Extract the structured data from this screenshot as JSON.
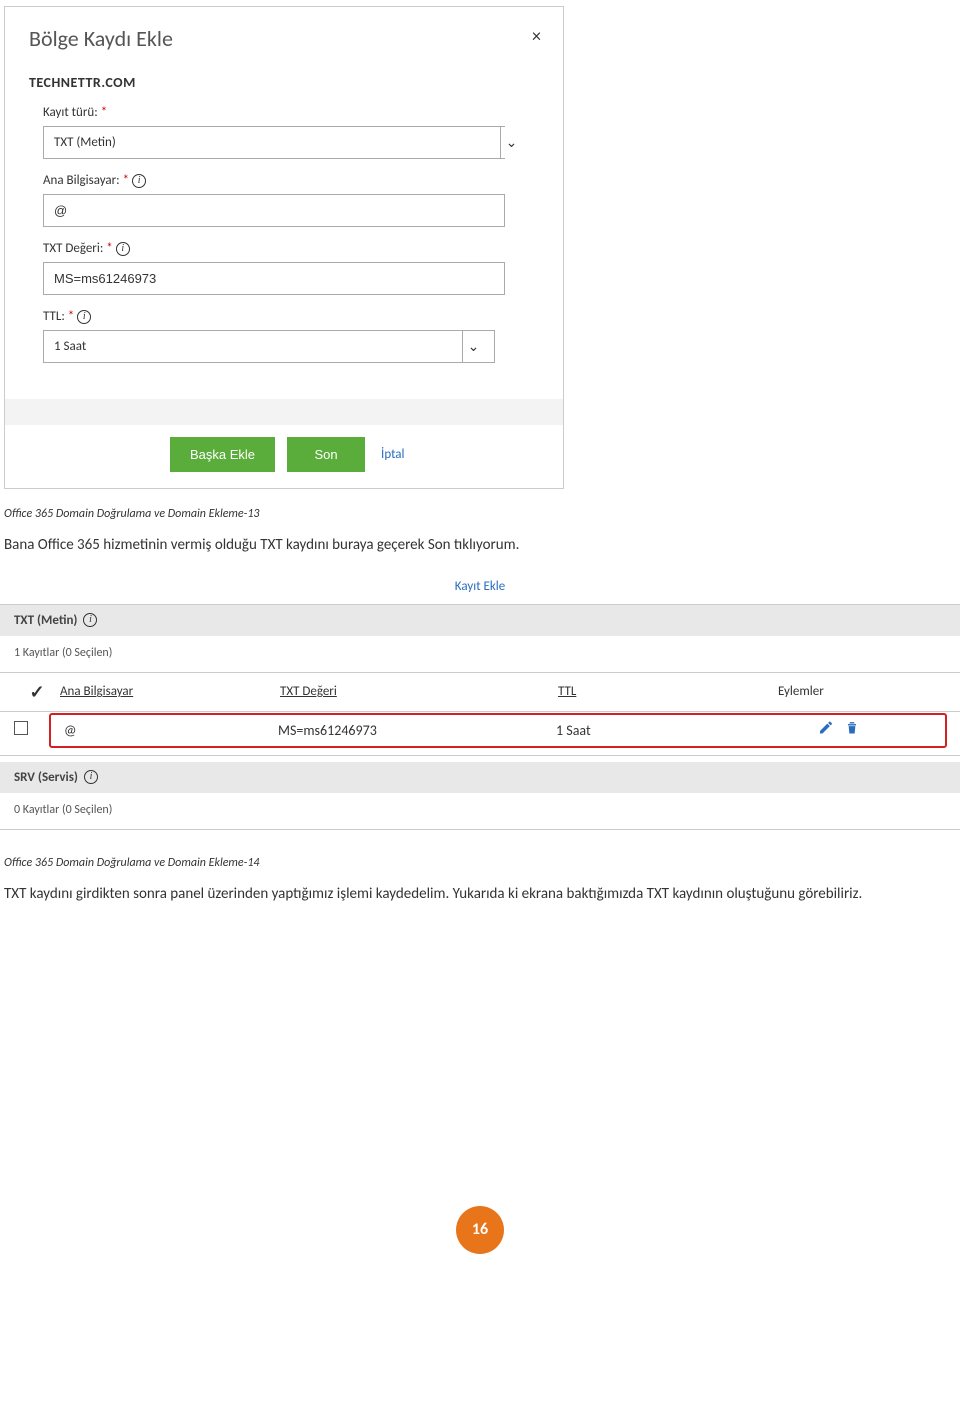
{
  "modal": {
    "title": "Bölge Kaydı Ekle",
    "close": "×",
    "domain": "TECHNETTR.COM",
    "fields": {
      "type": {
        "label": "Kayıt türü:",
        "value": "TXT (Metin)"
      },
      "host": {
        "label": "Ana Bilgisayar:",
        "value": "@"
      },
      "txtval": {
        "label": "TXT Değeri:",
        "value": "MS=ms61246973"
      },
      "ttl": {
        "label": "TTL:",
        "value": "1 Saat"
      }
    },
    "buttons": {
      "addAnother": "Başka Ekle",
      "finish": "Son",
      "cancel": "İptal"
    }
  },
  "caption1": "Office 365 Domain Doğrulama ve Domain Ekleme-13",
  "para1": "Bana Office 365 hizmetinin vermiş olduğu TXT kaydını buraya geçerek Son tıklıyorum.",
  "addRecord": "Kayıt Ekle",
  "txtSection": {
    "title": "TXT (Metin)",
    "count": "1 Kayıtlar (0 Seçilen)",
    "headers": {
      "host": "Ana Bilgisayar",
      "val": "TXT Değeri",
      "ttl": "TTL",
      "act": "Eylemler"
    },
    "row": {
      "host": "@",
      "val": "MS=ms61246973",
      "ttl": "1 Saat"
    }
  },
  "srvSection": {
    "title": "SRV (Servis)",
    "count": "0 Kayıtlar (0 Seçilen)"
  },
  "caption2": "Office 365 Domain Doğrulama ve Domain Ekleme-14",
  "para2": "TXT kaydını girdikten sonra panel üzerinden yaptığımız işlemi kaydedelim. Yukarıda ki ekrana baktığımızda TXT kaydının oluştuğunu görebiliriz.",
  "pageNum": "16"
}
